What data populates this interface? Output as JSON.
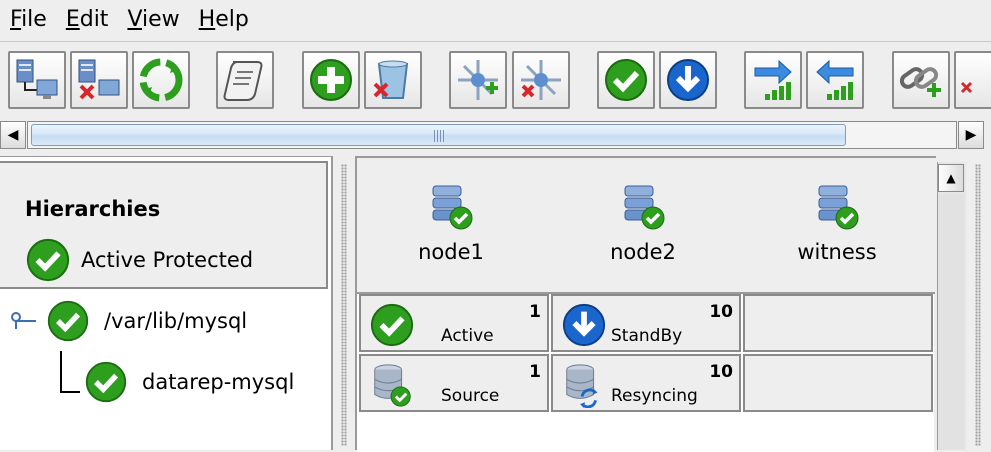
{
  "menu": [
    {
      "mnemonic": "F",
      "rest": "ile"
    },
    {
      "mnemonic": "E",
      "rest": "dit"
    },
    {
      "mnemonic": "V",
      "rest": "iew"
    },
    {
      "mnemonic": "H",
      "rest": "elp"
    }
  ],
  "toolbar": {
    "buttons": [
      {
        "icon": "connect-server-icon"
      },
      {
        "icon": "disconnect-server-icon"
      },
      {
        "icon": "refresh-icon"
      },
      {
        "icon": "view-log-icon"
      },
      {
        "icon": "create-resource-icon"
      },
      {
        "icon": "delete-resource-icon"
      },
      {
        "icon": "create-comm-path-icon"
      },
      {
        "icon": "delete-comm-path-icon"
      },
      {
        "icon": "in-service-icon"
      },
      {
        "icon": "out-of-service-icon"
      },
      {
        "icon": "extend-resource-icon"
      },
      {
        "icon": "unextend-resource-icon"
      },
      {
        "icon": "create-dependency-icon"
      },
      {
        "icon": "delete-dependency-icon"
      }
    ]
  },
  "hierarchies": {
    "title": "Hierarchies",
    "status": "Active Protected",
    "tree": [
      {
        "label": "/var/lib/mysql",
        "level": 0
      },
      {
        "label": "datarep-mysql",
        "level": 1
      }
    ]
  },
  "servers": [
    "node1",
    "node2",
    "witness"
  ],
  "status_rows": [
    [
      {
        "state": "Active",
        "priority": "1",
        "icon": "active-check-icon"
      },
      {
        "state": "StandBy",
        "priority": "10",
        "icon": "standby-arrow-icon"
      },
      {
        "state": "",
        "priority": ""
      }
    ],
    [
      {
        "state": "Source",
        "priority": "1",
        "icon": "mirror-source-icon"
      },
      {
        "state": "Resyncing",
        "priority": "10",
        "icon": "mirror-resyncing-icon"
      },
      {
        "state": "",
        "priority": ""
      }
    ]
  ],
  "colors": {
    "active_green": "#2e9e1f",
    "standby_blue": "#1a66cc",
    "scroll_thumb": "#c6dcf3"
  }
}
